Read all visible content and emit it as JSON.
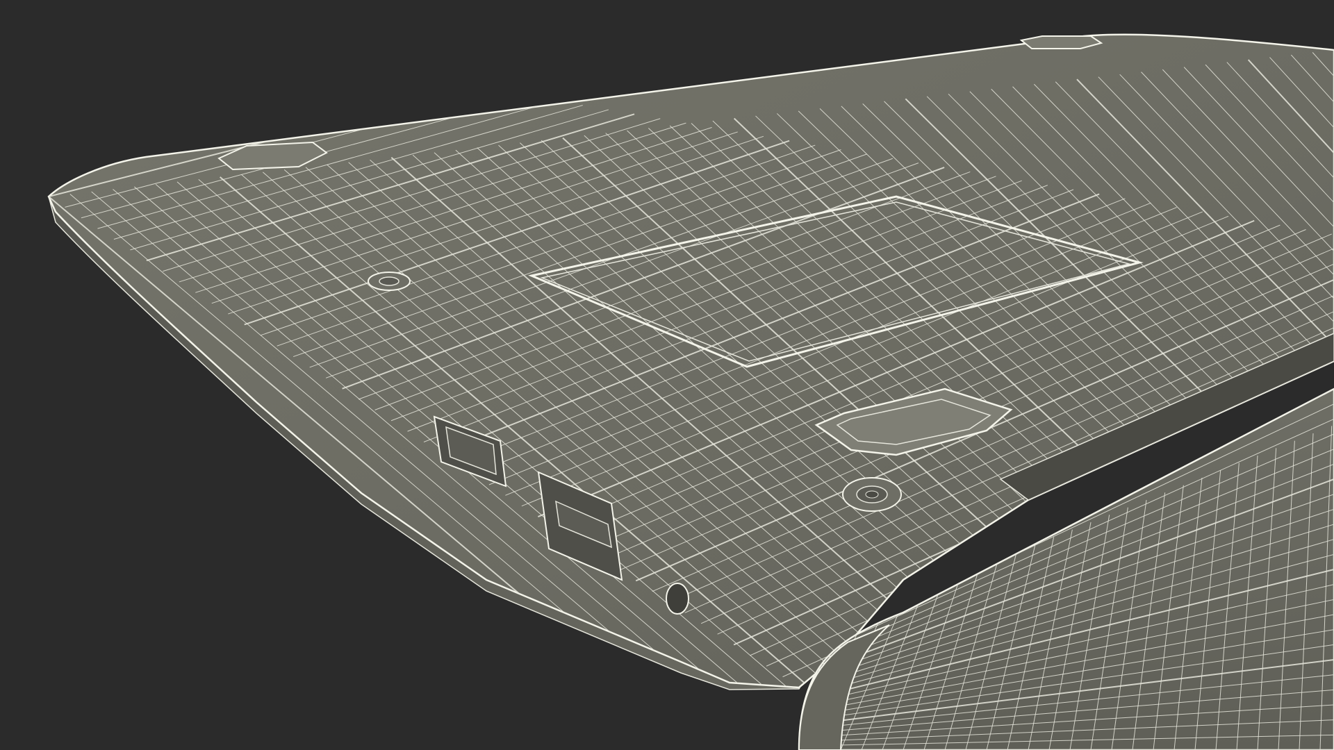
{
  "scene": {
    "subject": "laptop-wireframe-render",
    "colors": {
      "background": "#2b2b2b",
      "surface": "#6f6f66",
      "surface_dark": "#5c5c55",
      "surface_light": "#7a7a70",
      "wire": "#e6e6dc",
      "wire_strong": "#f4f4ea",
      "shadow": "#3a3a36"
    }
  }
}
